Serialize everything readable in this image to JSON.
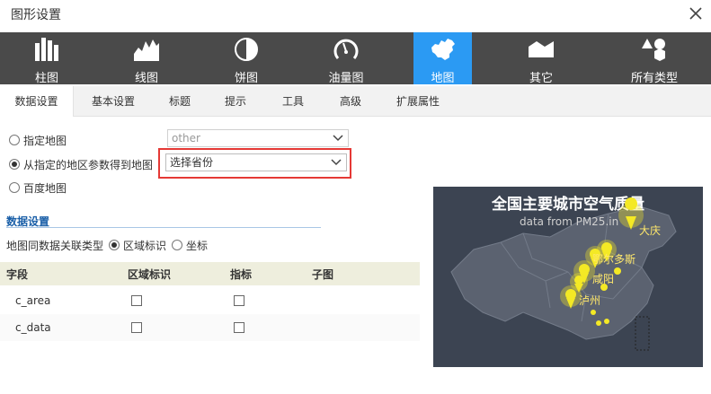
{
  "window": {
    "title": "图形设置"
  },
  "chart_types": [
    {
      "label": "柱图",
      "icon": "bar-chart-icon"
    },
    {
      "label": "线图",
      "icon": "line-chart-icon"
    },
    {
      "label": "饼图",
      "icon": "pie-chart-icon"
    },
    {
      "label": "油量图",
      "icon": "gauge-icon"
    },
    {
      "label": "地图",
      "icon": "map-china-icon",
      "active": true
    },
    {
      "label": "其它",
      "icon": "area-shape-icon"
    },
    {
      "label": "所有类型",
      "icon": "shapes-icon"
    }
  ],
  "tabs": [
    "数据设置",
    "基本设置",
    "标题",
    "提示",
    "工具",
    "高级",
    "扩展属性"
  ],
  "map_source": {
    "options": [
      {
        "label": "指定地图",
        "selected": false
      },
      {
        "label": "从指定的地区参数得到地图",
        "selected": true
      },
      {
        "label": "百度地图",
        "selected": false
      }
    ],
    "specified_map_value": "other",
    "province_value": "选择省份"
  },
  "data_settings": {
    "title": "数据设置",
    "assoc_label": "地图同数据关联类型",
    "assoc_options": [
      {
        "label": "区域标识",
        "selected": true
      },
      {
        "label": "坐标",
        "selected": false
      }
    ]
  },
  "grid": {
    "headers": [
      "字段",
      "区域标识",
      "指标",
      "子图"
    ],
    "rows": [
      {
        "field": "c_area",
        "area_id": false,
        "metric": false
      },
      {
        "field": "c_data",
        "area_id": false,
        "metric": false
      }
    ]
  },
  "preview": {
    "title": "全国主要城市空气质量",
    "subtitle": "data from PM25.in",
    "cities": [
      "大庆",
      "鄂尔多斯",
      "咸阳",
      "泸州"
    ],
    "colors": {
      "background": "#3c4452",
      "land": "#5b6270",
      "marker": "#f4e925"
    }
  },
  "colors": {
    "accent": "#2b9af3",
    "typebar": "#4a4a4a",
    "highlight": "#e53935"
  }
}
